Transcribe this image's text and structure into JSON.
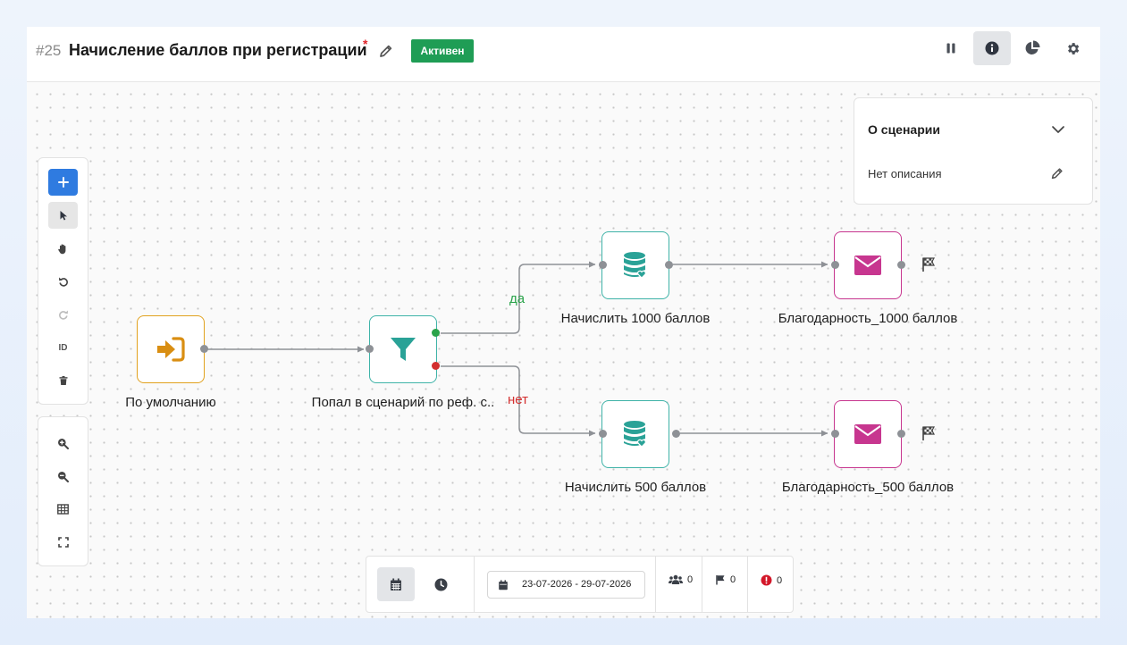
{
  "header": {
    "scenario_number": "#25",
    "title": "Начисление баллов при регистрации",
    "required_marker": "*",
    "status_badge": "Активен"
  },
  "nodes": {
    "start": {
      "label": "По умолчанию",
      "icon": "sign-in-icon"
    },
    "filter": {
      "label": "Попал в сценарий по реф. с..",
      "icon": "funnel-icon"
    },
    "award_1000": {
      "label": "Начислить 1000 баллов",
      "icon": "database-heart-icon"
    },
    "award_500": {
      "label": "Начислить 500 баллов",
      "icon": "database-heart-icon"
    },
    "thanks_1000": {
      "label": "Благодарность_1000 баллов",
      "icon": "envelope-icon"
    },
    "thanks_500": {
      "label": "Благодарность_500 баллов",
      "icon": "envelope-icon"
    }
  },
  "edges": {
    "yes_label": "да",
    "no_label": "нет"
  },
  "info_panel": {
    "title": "О сценарии",
    "description": "Нет описания"
  },
  "toolbox": {
    "id_label": "ID"
  },
  "bottom_bar": {
    "date_range": "23-07-2026 - 29-07-2026",
    "users_count": "0",
    "goals_count": "0",
    "errors_count": "0"
  },
  "colors": {
    "status_green": "#1f9d55",
    "primary_blue": "#2f7be0",
    "start_orange": "#e1a11e",
    "filter_teal": "#3fb3a8",
    "message_pink": "#c7368f",
    "yes_green": "#2aa34a",
    "no_red": "#d32f2f"
  }
}
